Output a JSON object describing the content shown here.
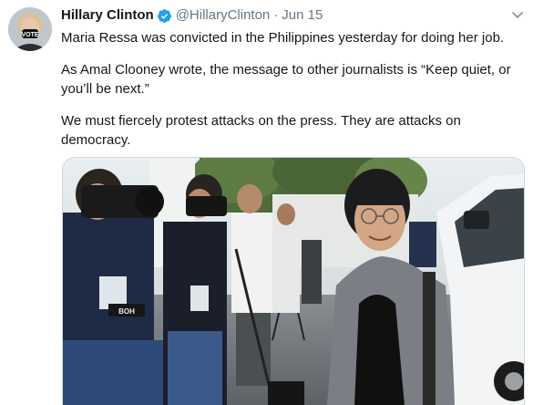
{
  "tweet": {
    "author_name": "Hillary Clinton",
    "handle": "@HillaryClinton",
    "separator": "·",
    "date": "Jun 15",
    "paragraphs": [
      "Maria Ressa was convicted in the Philippines yesterday for doing her job.",
      "As Amal Clooney wrote, the message to other journalists is “Keep quiet, or you’ll be next.”",
      "We must fiercely protest attacks on the press. They are attacks on democracy."
    ],
    "avatar_mask_text": "VOTE",
    "photo_vest_text": "BOH"
  },
  "colors": {
    "text": "#14171a",
    "secondary": "#657786",
    "verified": "#1da1f2",
    "border": "#ccd6dd"
  },
  "icons": {
    "verified": "verified-badge-icon",
    "caret": "chevron-down-icon"
  }
}
